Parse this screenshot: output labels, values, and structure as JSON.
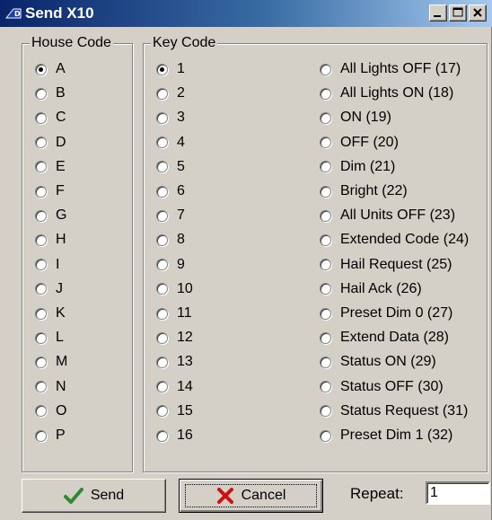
{
  "window": {
    "title": "Send X10",
    "icons": {
      "app": "x10-app-icon",
      "minimize": "minimize-icon",
      "maximize": "maximize-icon",
      "close": "close-icon"
    }
  },
  "house_code": {
    "label": "House Code",
    "selected": "A",
    "options": [
      "A",
      "B",
      "C",
      "D",
      "E",
      "F",
      "G",
      "H",
      "I",
      "J",
      "K",
      "L",
      "M",
      "N",
      "O",
      "P"
    ]
  },
  "key_code": {
    "label": "Key Code",
    "selected": "1",
    "numbers": [
      "1",
      "2",
      "3",
      "4",
      "5",
      "6",
      "7",
      "8",
      "9",
      "10",
      "11",
      "12",
      "13",
      "14",
      "15",
      "16"
    ],
    "functions": [
      "All Lights OFF  (17)",
      "All Lights ON  (18)",
      "ON  (19)",
      "OFF  (20)",
      "Dim  (21)",
      "Bright  (22)",
      "All Units OFF  (23)",
      "Extended Code  (24)",
      "Hail Request  (25)",
      "Hail Ack  (26)",
      "Preset Dim 0  (27)",
      "Extend Data  (28)",
      "Status ON  (29)",
      "Status OFF  (30)",
      "Status Request  (31)",
      "Preset Dim 1  (32)"
    ]
  },
  "buttons": {
    "send": {
      "label": "Send",
      "icon": "checkmark-icon",
      "icon_color": "#2e8b2e"
    },
    "cancel": {
      "label": "Cancel",
      "icon": "x-icon",
      "icon_color": "#cc1111"
    }
  },
  "repeat": {
    "label": "Repeat:",
    "value": "1"
  }
}
